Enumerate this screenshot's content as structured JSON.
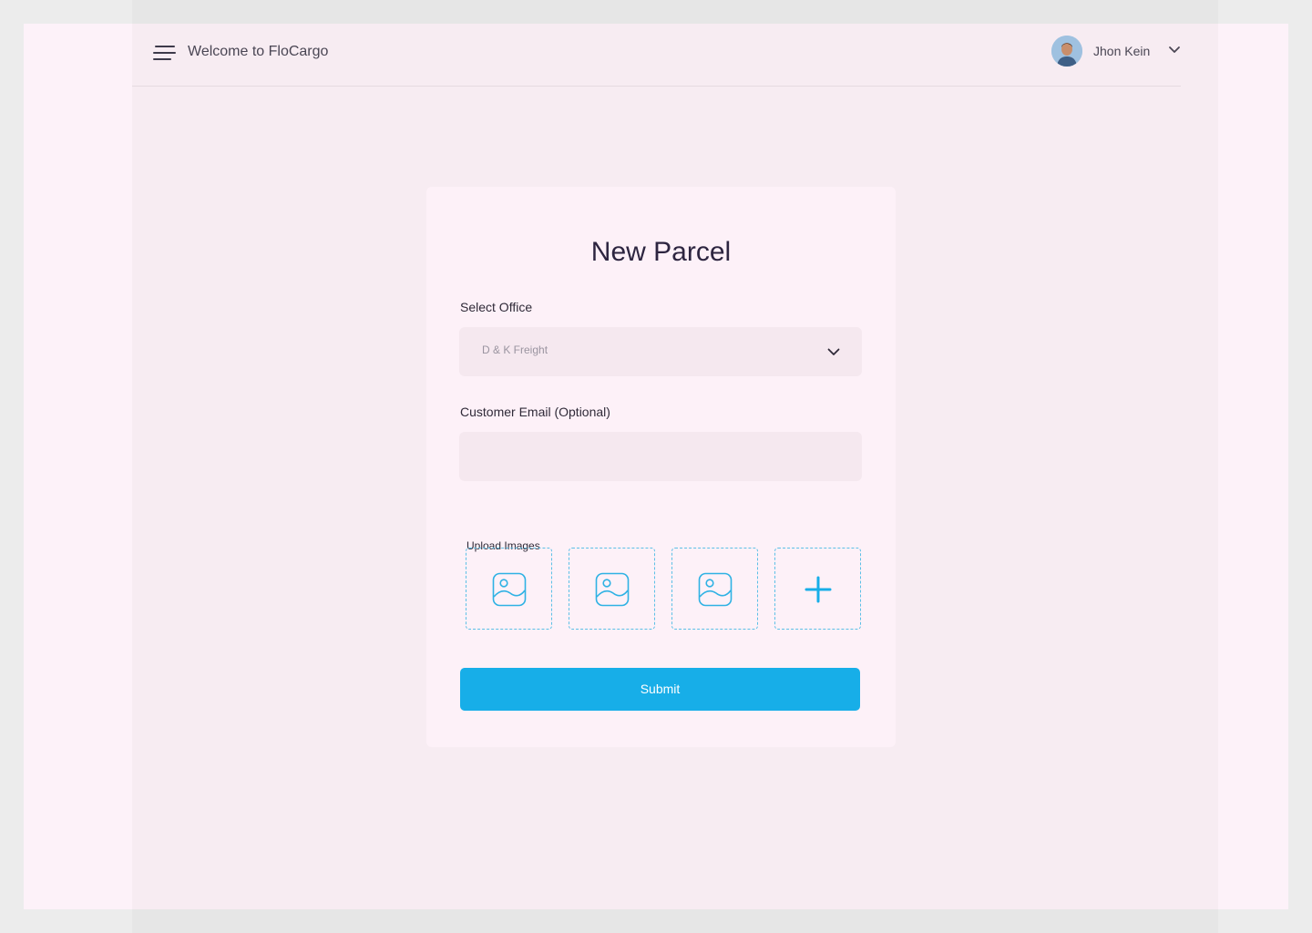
{
  "header": {
    "welcome_text": "Welcome to FloCargo",
    "user_name": "Jhon Kein"
  },
  "form": {
    "title": "New Parcel",
    "office_label": "Select Office",
    "office_value": "D & K Freight",
    "email_label": "Customer Email (Optional)",
    "email_value": "",
    "upload_label": "Upload Images",
    "image_slots": [
      "image-icon",
      "image-icon",
      "image-icon"
    ],
    "add_slot_icon": "plus-icon",
    "submit_label": "Submit"
  },
  "colors": {
    "accent": "#17aee8",
    "title": "#2d2540",
    "background": "#f7ecf2",
    "card": "#fdf1f8"
  }
}
